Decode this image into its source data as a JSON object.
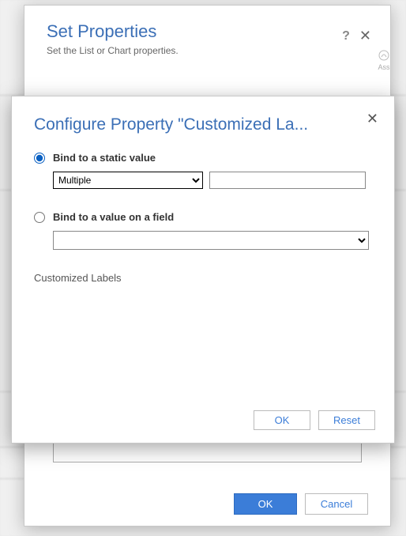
{
  "outer": {
    "title": "Set Properties",
    "subtitle": "Set the List or Chart properties.",
    "help_icon": "?",
    "close_icon": "✕",
    "ok_label": "OK",
    "cancel_label": "Cancel"
  },
  "inner": {
    "title": "Configure Property \"Customized La...",
    "close_icon": "✕",
    "option_static": {
      "label": "Bind to a static value",
      "selected_dropdown_value": "Multiple",
      "text_value": ""
    },
    "option_field": {
      "label": "Bind to a value on a field",
      "dropdown_value": ""
    },
    "section_label": "Customized Labels",
    "ok_label": "OK",
    "reset_label": "Reset"
  },
  "bg": {
    "side_label": "Ass"
  }
}
